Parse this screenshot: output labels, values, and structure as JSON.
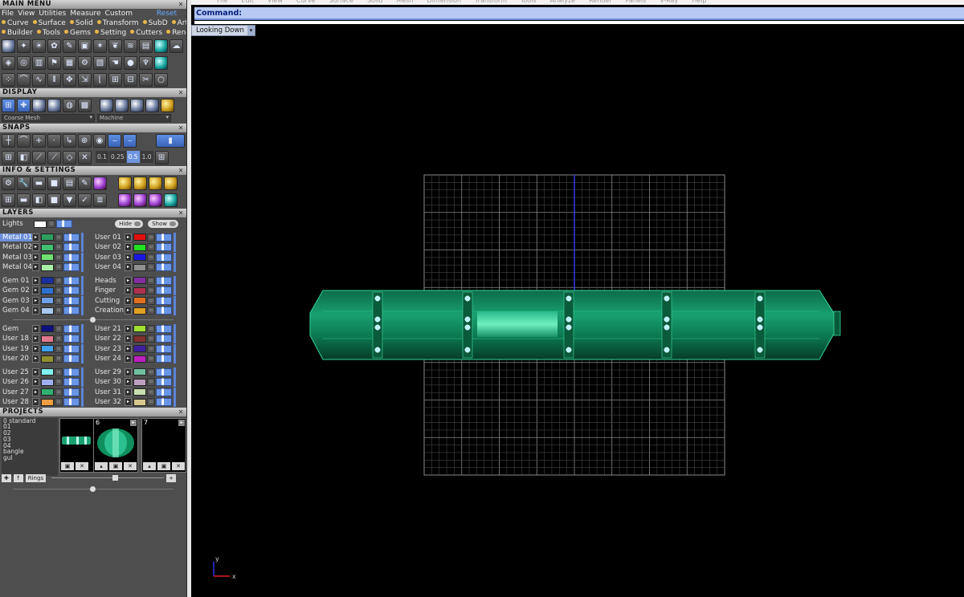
{
  "main_menu": {
    "title": "MAIN MENU",
    "row1": [
      "File",
      "View",
      "Utilities",
      "Measure",
      "Custom"
    ],
    "reset": "Reset",
    "row2": [
      "Curve",
      "Surface",
      "Solid",
      "Transform",
      "SubD",
      "Art"
    ],
    "row3": [
      "Builder",
      "Tools",
      "Gems",
      "Setting",
      "Cutters",
      "Render"
    ]
  },
  "display": {
    "title": "DISPLAY",
    "mesh_select": "Coarse Mesh",
    "material_select": "Machine"
  },
  "snaps": {
    "title": "SNAPS",
    "values": [
      "0.1",
      "0.25",
      "0.5",
      "1.0"
    ],
    "active": "0.5"
  },
  "info": {
    "title": "INFO & SETTINGS"
  },
  "layers": {
    "title": "LAYERS",
    "lights": "Lights",
    "hide": "Hide",
    "show": "Show",
    "groups": [
      {
        "left": [
          [
            "Metal 01",
            "#2e9e5e"
          ],
          [
            "Metal 02",
            "#40c070"
          ],
          [
            "Metal 03",
            "#70e070"
          ],
          [
            "Metal 04",
            "#a8f0a8"
          ]
        ],
        "right": [
          [
            "User 01",
            "#e01010"
          ],
          [
            "User 02",
            "#20e020"
          ],
          [
            "User 03",
            "#1818e0"
          ],
          [
            "User 04",
            "#909090"
          ]
        ]
      },
      {
        "left": [
          [
            "Gem 01",
            "#1830a0"
          ],
          [
            "Gem 02",
            "#3070d0"
          ],
          [
            "Gem 03",
            "#70a0e8"
          ],
          [
            "Gem 04",
            "#a8c8f0"
          ]
        ],
        "right": [
          [
            "Heads",
            "#8030a0"
          ],
          [
            "Finger",
            "#b03050"
          ],
          [
            "Cutting",
            "#e07020"
          ],
          [
            "Creation",
            "#e0a020"
          ]
        ]
      },
      {
        "left": [
          [
            "Gem",
            "#101080"
          ],
          [
            "User 18",
            "#e07890"
          ],
          [
            "User 19",
            "#40a0f0"
          ],
          [
            "User 20",
            "#909030"
          ]
        ],
        "right": [
          [
            "User 21",
            "#a0e030"
          ],
          [
            "User 22",
            "#803030"
          ],
          [
            "User 23",
            "#4020a0"
          ],
          [
            "User 24",
            "#c020c0"
          ]
        ]
      },
      {
        "left": [
          [
            "User 25",
            "#80f0f0"
          ],
          [
            "User 26",
            "#a0b0f0"
          ],
          [
            "User 27",
            "#30b070"
          ],
          [
            "User 28",
            "#f0a040"
          ]
        ],
        "right": [
          [
            "User 29",
            "#70c0a0"
          ],
          [
            "User 30",
            "#c0a0c0"
          ],
          [
            "User 31",
            "#c8e0b0"
          ],
          [
            "User 32",
            "#d8c890"
          ]
        ]
      }
    ]
  },
  "projects": {
    "title": "PROJECTS",
    "list": [
      "0 standard",
      "01",
      "02",
      "03",
      "04",
      "bangle",
      "gul"
    ],
    "thumb_labels": [
      "6",
      "7"
    ],
    "button_rings": "Rings"
  },
  "app_menu": [
    "File",
    "Edit",
    "View",
    "Curve",
    "Surface",
    "Solid",
    "Mesh",
    "Dimension",
    "Transform",
    "Tools",
    "Analyze",
    "Render",
    "Panels",
    "V-Ray",
    "Help"
  ],
  "command": {
    "label": "Command:"
  },
  "viewport": {
    "view_name": "Looking Down",
    "axis_y": "y",
    "axis_x": "x",
    "model_color": "#0f8e5e"
  }
}
